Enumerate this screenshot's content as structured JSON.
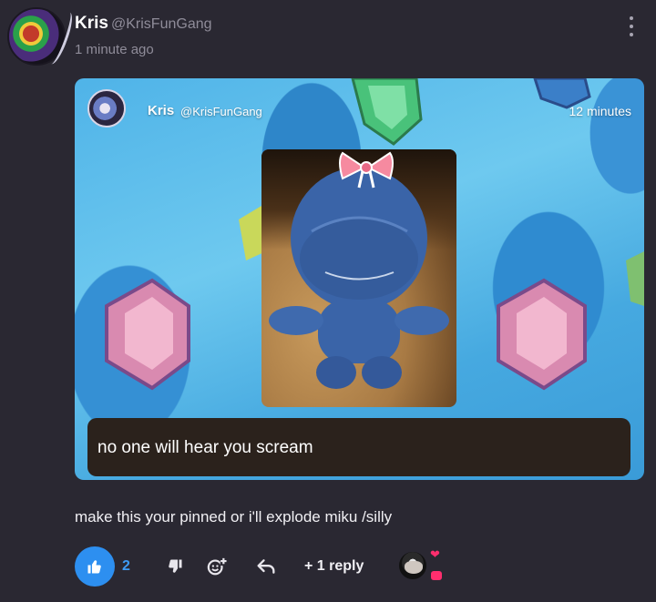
{
  "post": {
    "author_name": "Kris",
    "author_handle": "@KrisFunGang",
    "timestamp": "1 minute ago",
    "body": "make this your pinned or i'll explode miku /silly"
  },
  "embed": {
    "author_name": "Kris",
    "author_handle": "@KrisFunGang",
    "timestamp": "12 minutes",
    "caption": "no one will hear you scream"
  },
  "actions": {
    "like_count": "2",
    "reply_label": "+ 1 reply",
    "icons": [
      "thumbs-up-icon",
      "thumbs-down-icon",
      "add-reaction-icon",
      "reply-icon"
    ]
  },
  "reactions": {
    "icons": [
      "heart-icon",
      "chat-bubble-icon"
    ]
  },
  "colors": {
    "background": "#2a2832",
    "accent_blue": "#2d8ff0",
    "heart_pink": "#ff2e6e",
    "muted_text": "#8f8c99"
  }
}
